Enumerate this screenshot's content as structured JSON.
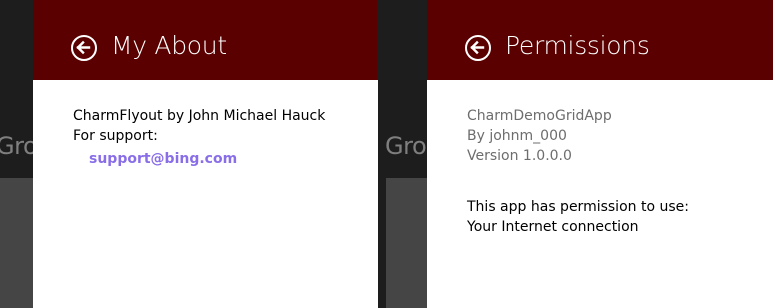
{
  "background": {
    "left_fragment": "Gro",
    "right_fragment": "Gro"
  },
  "about_flyout": {
    "title": "My About",
    "back_icon": "back-arrow-circle-icon",
    "author_line": "CharmFlyout by John Michael Hauck",
    "support_label": "For support:",
    "support_link": "support@bing.com"
  },
  "permissions_flyout": {
    "title": "Permissions",
    "back_icon": "back-arrow-circle-icon",
    "app_name": "CharmDemoGridApp",
    "publisher": "By johnm_000",
    "version": "Version 1.0.0.0",
    "permission_heading": "This app has permission to use:",
    "permission_item": "Your Internet connection"
  },
  "colors": {
    "header": "#5a0000",
    "link": "#8a6ee8"
  }
}
